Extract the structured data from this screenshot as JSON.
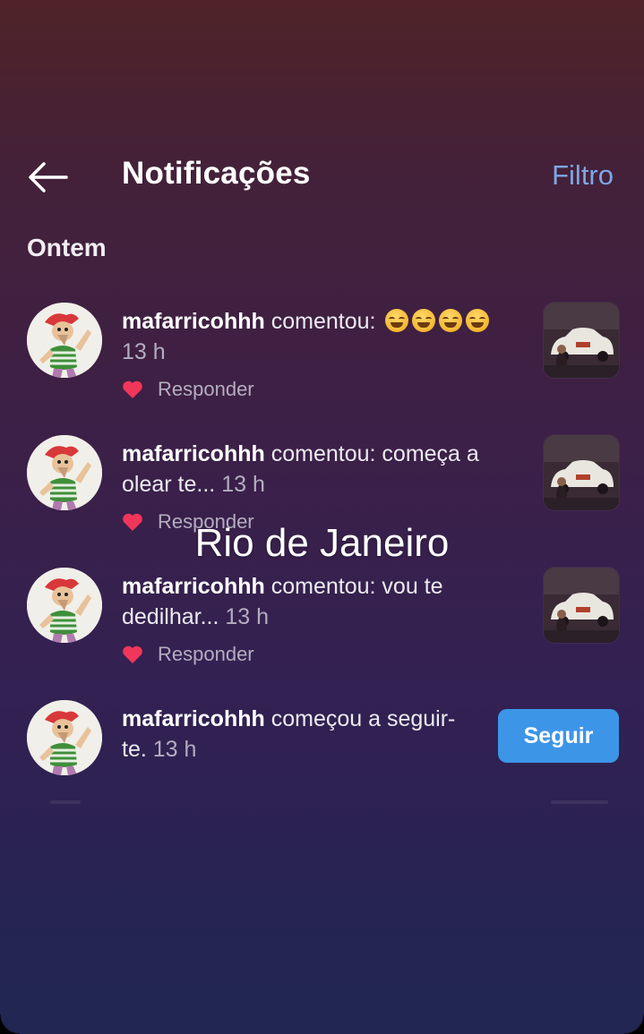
{
  "header": {
    "title": "Notificações",
    "filter_label": "Filtro",
    "back_icon": "arrow-left-icon"
  },
  "section": {
    "label": "Ontem"
  },
  "notifications": [
    {
      "username": "mafarricohhh",
      "action": "comentou:",
      "text": "",
      "emojis": [
        "grinning-face",
        "grinning-face",
        "grinning-face",
        "grinning-face"
      ],
      "time": "13 h",
      "reply_label": "Responder"
    },
    {
      "username": "mafarricohhh",
      "action": "comentou:",
      "text": "começa a olear te...",
      "time": "13 h",
      "reply_label": "Responder"
    },
    {
      "username": "mafarricohhh",
      "action": "comentou:",
      "text": "vou te dedilhar...",
      "time": "13 h",
      "reply_label": "Responder"
    },
    {
      "username": "mafarricohhh",
      "action": "começou a seguir-te.",
      "time": "13 h",
      "follow_label": "Seguir"
    }
  ],
  "overlay": {
    "caption": "Rio de Janeiro"
  },
  "colors": {
    "accent_link": "#7da6e8",
    "follow_button": "#3d95e8",
    "heart": "#f0365a"
  }
}
